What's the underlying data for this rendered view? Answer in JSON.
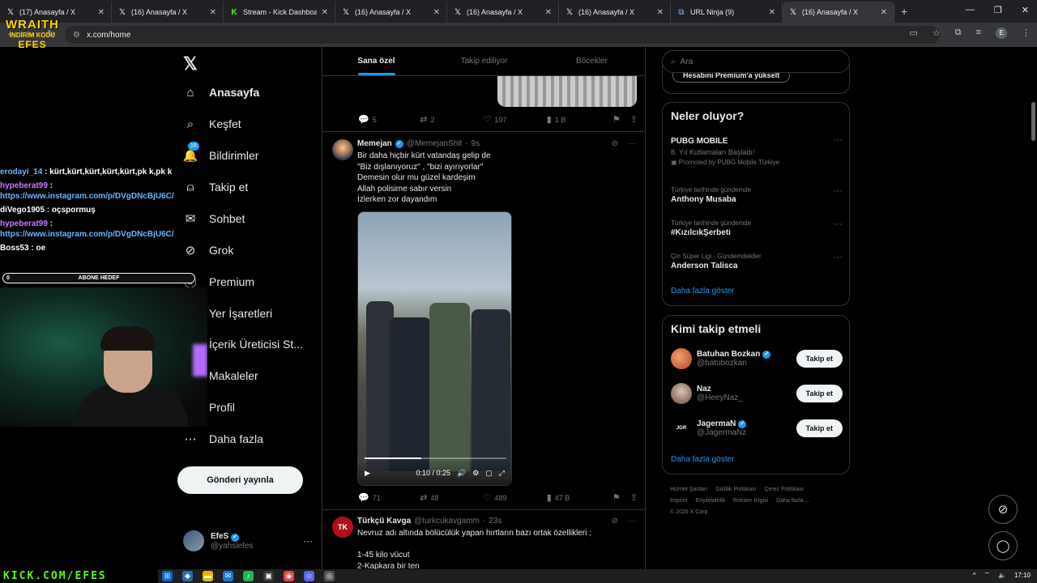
{
  "browser": {
    "tabs": [
      {
        "icon": "x-logo-icon",
        "title": "(17) Anasayfa / X",
        "active": false
      },
      {
        "icon": "x-logo-icon",
        "title": "(16) Anasayfa / X",
        "active": false
      },
      {
        "icon": "kick-logo-icon",
        "title": "Stream - Kick Dashboard",
        "active": false
      },
      {
        "icon": "x-logo-icon",
        "title": "(16) Anasayfa / X",
        "active": false
      },
      {
        "icon": "x-logo-icon",
        "title": "(16) Anasayfa / X",
        "active": false
      },
      {
        "icon": "x-logo-icon",
        "title": "(16) Anasayfa / X",
        "active": false
      },
      {
        "icon": "link-icon",
        "title": "URL Ninja (9)",
        "active": false
      },
      {
        "icon": "x-logo-icon",
        "title": "(16) Anasayfa / X",
        "active": true
      }
    ],
    "url": "x.com/home",
    "profile_initial": "E"
  },
  "overlay": {
    "brand_line1": "WRAITH",
    "brand_line2": "İNDİRİM KODU",
    "brand_line3": "EFES",
    "chat": [
      {
        "user": "erodayi_14",
        "msg": "kürt,kürt,kürt,kürt,kürt,pk k,pk k",
        "color": "u1",
        "link": false
      },
      {
        "user": "hypeberat99",
        "msg": "https://www.instagram.com/p/DVgDNcBjU6C/",
        "color": "u2",
        "link": true
      },
      {
        "user": "diVego1905",
        "msg": "oçspormuş",
        "color": "u3",
        "link": false
      },
      {
        "user": "hypeberat99",
        "msg": "https://www.instagram.com/p/DVgDNcBjU6C/",
        "color": "u2",
        "link": true
      },
      {
        "user": "Boss53",
        "msg": "oe",
        "color": "u3",
        "link": false
      }
    ],
    "goal_value": "0",
    "goal_label": "ABONE HEDEF",
    "bottom_banner": "KICK.COM/EFES"
  },
  "nav": {
    "items": [
      {
        "label": "Anasayfa",
        "icon": "home-icon",
        "bold": true
      },
      {
        "label": "Keşfet",
        "icon": "search-icon",
        "bold": false
      },
      {
        "label": "Bildirimler",
        "icon": "bell-icon",
        "bold": false,
        "badge": "16"
      },
      {
        "label": "Takip et",
        "icon": "add-person-icon",
        "bold": false
      },
      {
        "label": "Sohbet",
        "icon": "mail-icon",
        "bold": false
      },
      {
        "label": "Grok",
        "icon": "grok-icon",
        "bold": false
      },
      {
        "label": "Premium",
        "icon": "x-circle-icon",
        "bold": false
      },
      {
        "label": "Yer İşaretleri",
        "icon": "bookmark-icon",
        "bold": false
      },
      {
        "label": "İçerik Üreticisi St...",
        "icon": "creator-icon",
        "bold": false
      },
      {
        "label": "Makaleler",
        "icon": "article-icon",
        "bold": false
      },
      {
        "label": "Profil",
        "icon": "person-icon",
        "bold": false
      },
      {
        "label": "Daha fazla",
        "icon": "more-circle-icon",
        "bold": false
      }
    ],
    "post_button": "Gönderi yayınla",
    "profile_name": "EfeS",
    "profile_handle": "@yahslefes"
  },
  "timeline": {
    "tabs": [
      "Sana özel",
      "Takip ediliyor",
      "Böcekler"
    ],
    "prev_actions": {
      "replies": "5",
      "reposts": "2",
      "likes": "107",
      "views": "1 B"
    },
    "tweet1": {
      "name": "Memejan",
      "handle": "@MemejanShit",
      "time": "9s",
      "lines": [
        "Bir daha hiçbir kürt vatandaş gelip de",
        "\"Biz dışlanıyoruz\" , \"bizi ayırıyorlar\"",
        "Demesin olur mu güzel kardeşim",
        "Allah polisime sabır versin",
        "İzlerken zor dayandım"
      ],
      "video_time": "0:10 / 0:25",
      "video_progress": 0.4,
      "replies": "71",
      "reposts": "48",
      "likes": "489",
      "views": "47 B"
    },
    "tweet2": {
      "name": "Türkçü Kavga",
      "handle": "@turkcukavgamm",
      "time": "23s",
      "lines": [
        "Nevruz adı altında bölücülük yapan hırtların bazı ortak özellikleri ;",
        "",
        "1-45 kilo vücut",
        "2-Kapkara bir ten"
      ]
    }
  },
  "sidebar": {
    "search_placeholder": "Ara",
    "premium_pill": "Hesabını Premium'a yükselt",
    "trends_title": "Neler oluyor?",
    "trends": [
      {
        "context": "",
        "title": "PUBG MOBILE",
        "sub": "8. Yıl Kutlamaları Başladı!",
        "promo": "Promoted by PUBG Mobile Türkiye"
      },
      {
        "context": "Türkiye tarihinde gündemde",
        "title": "Anthony Musaba",
        "sub": "",
        "promo": ""
      },
      {
        "context": "Türkiye tarihinde gündemde",
        "title": "#KızılcıkŞerbeti",
        "sub": "",
        "promo": ""
      },
      {
        "context": "Çin Süper Ligi · Gündemdekiler",
        "title": "Anderson Talisca",
        "sub": "",
        "promo": ""
      }
    ],
    "trends_more": "Daha fazla göster",
    "follow_title": "Kimi takip etmeli",
    "follow": [
      {
        "name": "Batuhan Bozkan",
        "handle": "@batubozkan",
        "verified": true,
        "button": "Takip et"
      },
      {
        "name": "Naz",
        "handle": "@HeeyNaz_",
        "verified": false,
        "button": "Takip et"
      },
      {
        "name": "JagermaN",
        "handle": "@JagermaNz",
        "verified": true,
        "button": "Takip et"
      }
    ],
    "follow_more": "Daha fazla göster",
    "footer": [
      "Hizmet Şartları",
      "Gizlilik Politikası",
      "Çerez Politikası",
      "Imprint",
      "Erişilebilirlik",
      "Reklam bilgisi",
      "Daha fazla ...",
      "© 2026 X Corp."
    ]
  },
  "taskbar": {
    "time": "17:10"
  },
  "colors": {
    "accent": "#1d9bf0",
    "kick_green": "#53fc18",
    "brand_yellow": "#ffd400"
  }
}
